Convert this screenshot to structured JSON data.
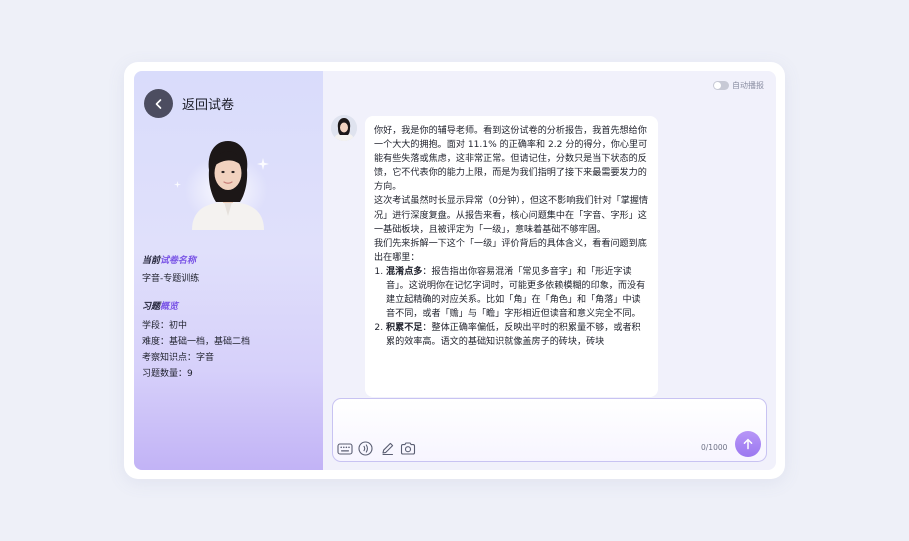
{
  "sidebar": {
    "back_label": "返回试卷",
    "section1": {
      "prefix": "当前",
      "highlight": "试卷名称"
    },
    "paper_name": "字音-专题训练",
    "section2": {
      "prefix": "习题",
      "highlight": "概览"
    },
    "info": [
      "学段：初中",
      "难度：基础一档，基础二档",
      "考察知识点：字音",
      "习题数量：9"
    ]
  },
  "toolbar": {
    "autoplay_label": "自动播报"
  },
  "message": {
    "paragraphs": [
      "你好，我是你的辅导老师。看到这份试卷的分析报告，我首先想给你一个大大的拥抱。面对 11.1% 的正确率和 2.2 分的得分，你心里可能有些失落或焦虑，这非常正常。但请记住，分数只是当下状态的反馈，它不代表你的能力上限，而是为我们指明了接下来最需要发力的方向。",
      "这次考试虽然时长显示异常（0分钟），但这不影响我们针对「掌握情况」进行深度复盘。从报告来看，核心问题集中在「字音、字形」这一基础板块，且被评定为「一级」，意味着基础不够牢固。",
      "我们先来拆解一下这个「一级」评价背后的具体含义，看看问题到底出在哪里："
    ],
    "list": [
      {
        "title": "混淆点多",
        "text": "：报告指出你容易混淆「常见多音字」和「形近字读音」。这说明你在记忆字词时，可能更多依赖模糊的印象，而没有建立起精确的对应关系。比如「角」在「角色」和「角落」中读音不同，或者「赡」与「瞻」字形相近但读音和意义完全不同。"
      },
      {
        "title": "积累不足",
        "text": "：整体正确率偏低，反映出平时的积累量不够，或者积累的效率高。语文的基础知识就像盖房子的砖块，砖块"
      }
    ]
  },
  "input": {
    "placeholder": "",
    "counter": "0/1000"
  },
  "icons": [
    "keyboard-icon",
    "voice-icon",
    "pen-icon",
    "camera-icon",
    "send-arrow-icon",
    "chevron-left-icon",
    "sparkle-icon"
  ],
  "colors": {
    "accent": "#8b66ee",
    "highlight": "#7a55e6",
    "back_button": "#4c4d60"
  }
}
